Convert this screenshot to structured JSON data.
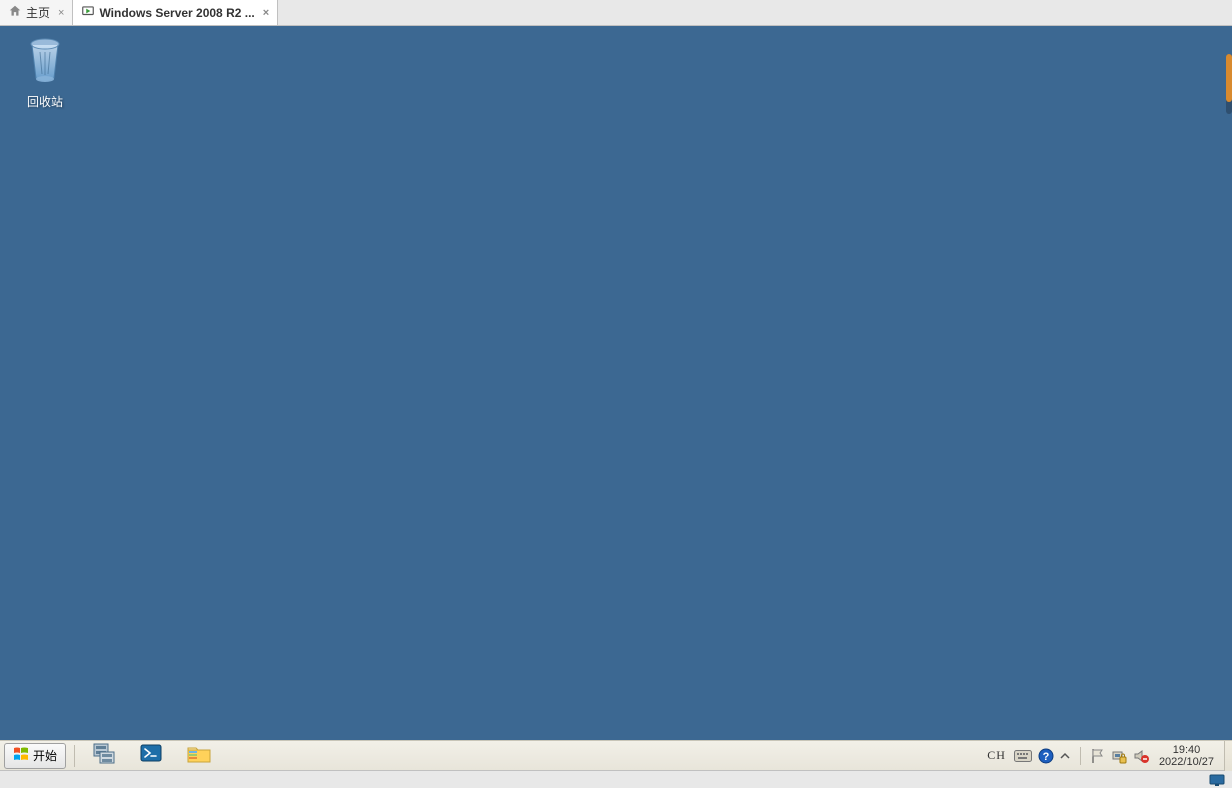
{
  "vm_tabs": [
    {
      "label": "主页",
      "active": false
    },
    {
      "label": "Windows Server 2008 R2 ...",
      "active": true
    }
  ],
  "desktop": {
    "recycle_bin_label": "回收站"
  },
  "taskbar": {
    "start_label": "开始",
    "language_indicator": "CH"
  },
  "clock": {
    "time": "19:40",
    "date": "2022/10/27"
  }
}
